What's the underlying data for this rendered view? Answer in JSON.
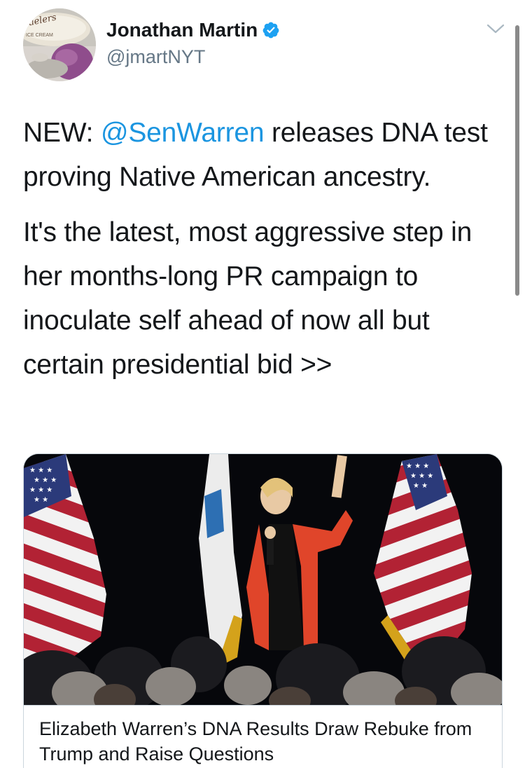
{
  "author": {
    "name": "Jonathan Martin",
    "handle": "@jmartNYT",
    "avatar_icon": "ice-cream-avatar-icon",
    "avatar_text": "ICE CREAM",
    "verified_icon": "verified-badge-icon"
  },
  "tweet": {
    "prefix": "NEW: ",
    "mention": "@SenWarren",
    "paragraph1_rest": " releases DNA test proving Native American ancestry.",
    "paragraph2": "It's the latest, most aggressive step in her months-long PR campaign to inoculate self ahead of now all but certain presidential bid >>"
  },
  "card": {
    "image_icon": "speaker-with-flags-photo",
    "title": "Elizabeth Warren’s DNA Results Draw Rebuke from Trump and Raise Questions"
  },
  "menu_icon": "chevron-down-icon",
  "colors": {
    "link": "#1b95e0",
    "text": "#14171a",
    "secondary": "#657786",
    "verified": "#1da1f2",
    "border": "#ccd6dd"
  }
}
